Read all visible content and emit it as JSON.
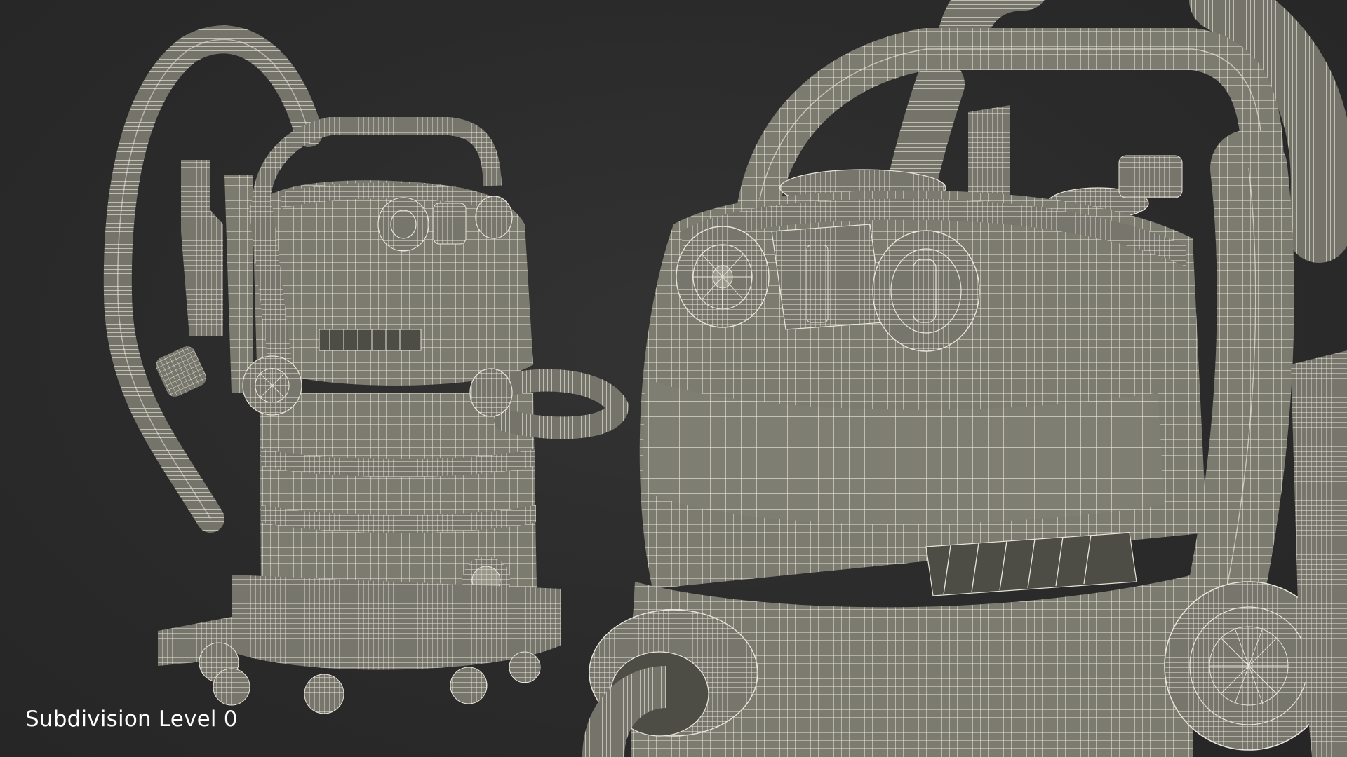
{
  "scene": {
    "caption": "Subdivision Level 0",
    "background_color": "#2b2b2b",
    "mesh_fill_color": "#7c7b70",
    "wire_color": "#e8e6da"
  }
}
